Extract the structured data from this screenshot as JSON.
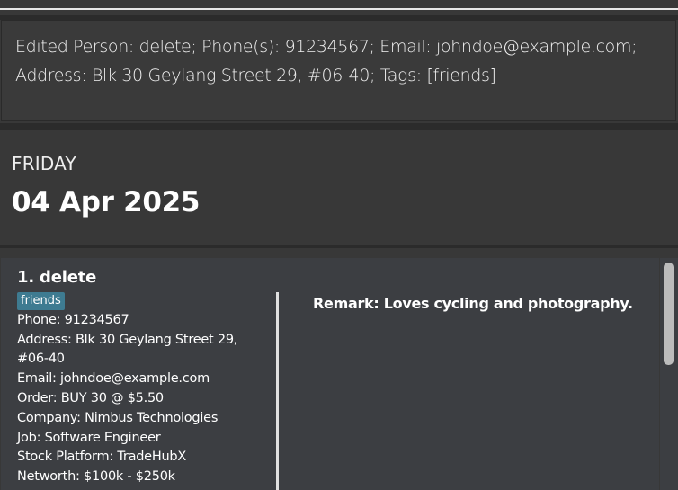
{
  "result": {
    "text": "Edited Person: delete; Phone(s): 91234567; Email: johndoe@example.com; Address: Blk 30 Geylang Street 29, #06-40; Tags: [friends]"
  },
  "calendar": {
    "day": "FRIDAY",
    "date": "04 Apr 2025"
  },
  "persons": [
    {
      "title": "1. delete",
      "tag": "friends",
      "phone": "Phone: 91234567",
      "address_line1": "Address: Blk 30 Geylang Street 29,",
      "address_line2": "#06-40",
      "email": "Email: johndoe@example.com",
      "order": "Order: BUY 30 @ $5.50",
      "company": "Company: Nimbus Technologies",
      "job": "Job: Software Engineer",
      "platform": "Stock Platform: TradeHubX",
      "networth": "Networth: $100k - $250k",
      "remark": "Remark: Loves cycling and photography."
    }
  ],
  "colors": {
    "background": "#383838",
    "card": "#3c3e42",
    "tag": "#3e7b91",
    "text": "#ffffff"
  }
}
